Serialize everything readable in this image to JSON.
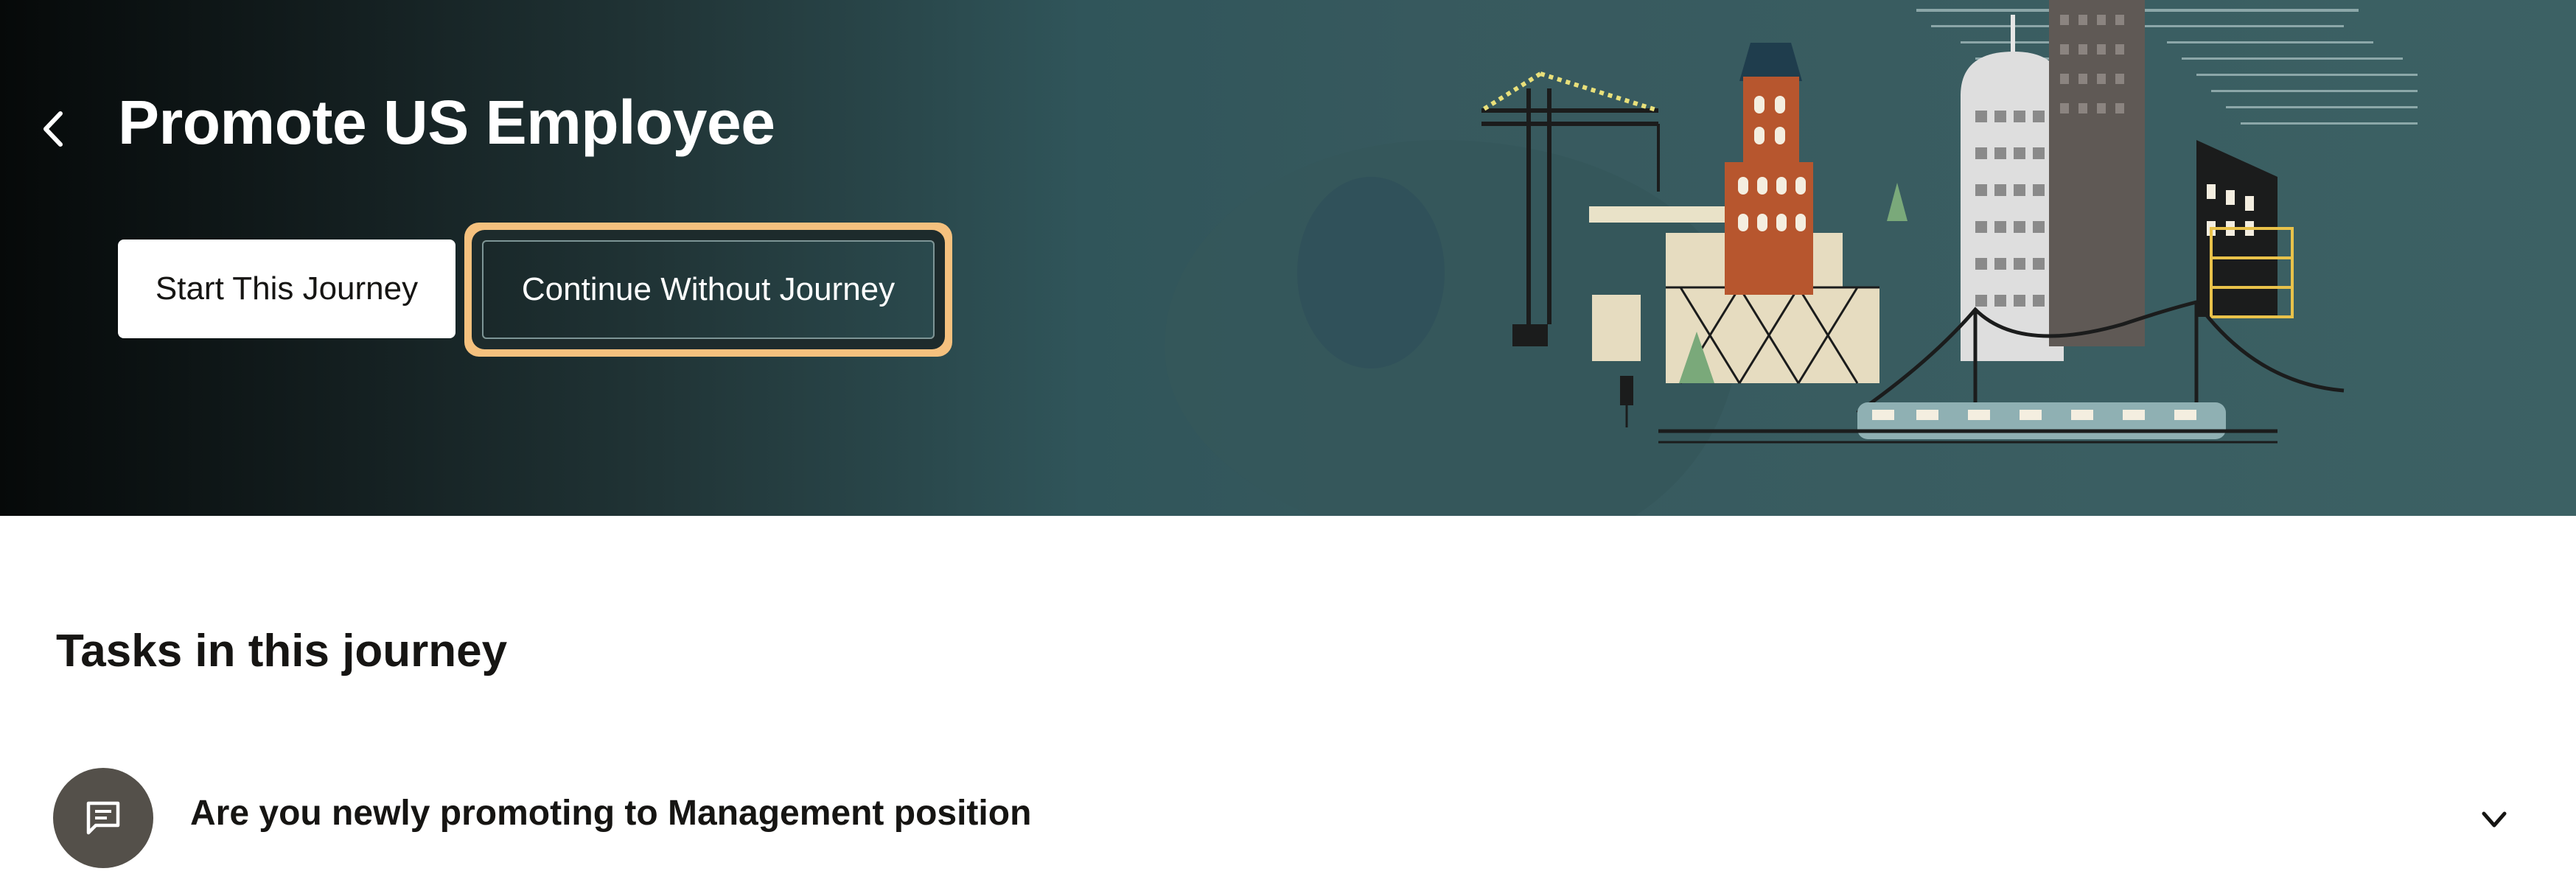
{
  "header": {
    "title": "Promote US Employee",
    "back_icon": "chevron-left-icon",
    "start_label": "Start This Journey",
    "continue_label": "Continue Without Journey"
  },
  "tasks": {
    "section_title": "Tasks in this journey",
    "items": [
      {
        "label": "Are you newly promoting to Management position",
        "icon": "chat-bubble-icon",
        "expand_icon": "chevron-down-icon"
      }
    ]
  },
  "colors": {
    "hero_dark": "#060909",
    "hero_teal": "#3c6164",
    "focus_ring": "#f5c17e",
    "text": "#161513",
    "task_icon_bg": "#54504a"
  }
}
